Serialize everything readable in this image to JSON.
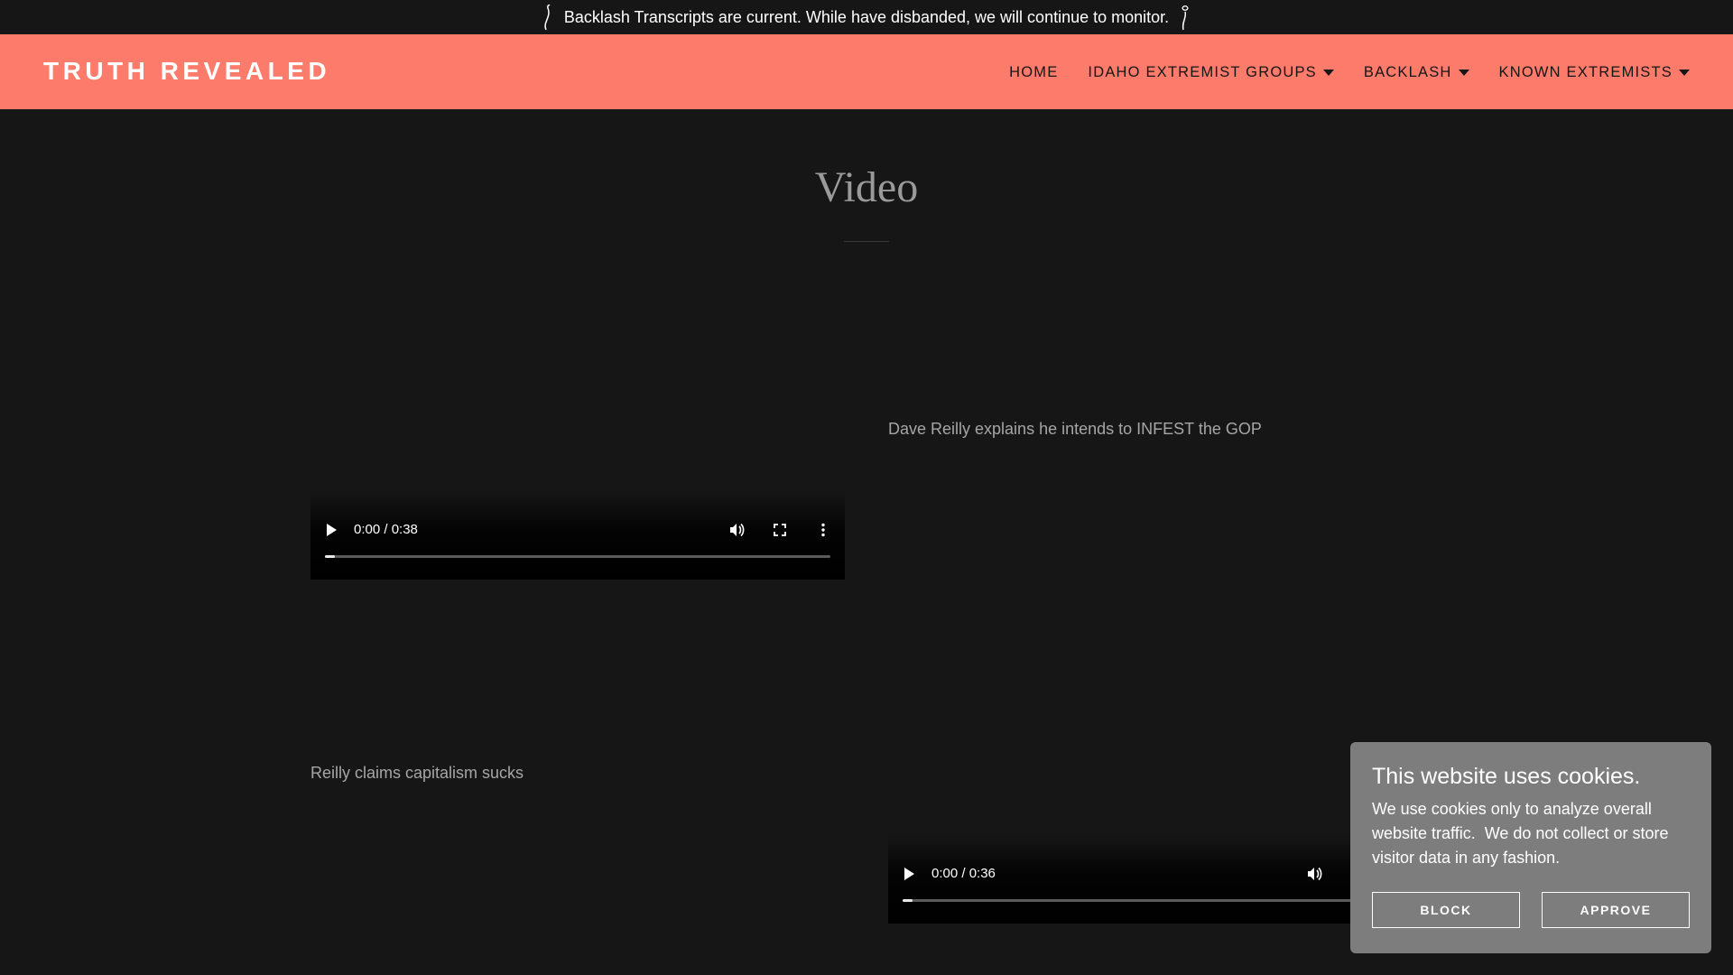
{
  "announcement": {
    "text": "Backlash Transcripts are current. While have disbanded, we will continue to monitor.",
    "icon_left": "flower-stem-icon",
    "icon_right": "rose-icon"
  },
  "header": {
    "brand": "TRUTH REVEALED",
    "background": "#fd7b6a",
    "nav": [
      {
        "label": "HOME",
        "dropdown": false
      },
      {
        "label": "IDAHO EXTREMIST GROUPS",
        "dropdown": true
      },
      {
        "label": "BACKLASH",
        "dropdown": true
      },
      {
        "label": "KNOWN EXTREMISTS",
        "dropdown": true
      }
    ]
  },
  "main": {
    "title": "Video",
    "items": [
      {
        "caption": "Dave Reilly explains he intends to INFEST the GOP"
      },
      {
        "caption": "Reilly claims capitalism sucks"
      }
    ],
    "videos": [
      {
        "time": "0:00 / 0:38",
        "progress": 0.02
      },
      {
        "time": "0:00 / 0:36",
        "progress": 0.02
      }
    ]
  },
  "cookie": {
    "title": "This website uses cookies.",
    "body": "We use cookies only to analyze overall website traffic.  We do not collect or store visitor data in any fashion.",
    "block_label": "BLOCK",
    "approve_label": "APPROVE"
  },
  "colors": {
    "accent": "#fd7b6a",
    "background": "#161616",
    "cookie_bg": "#7d7d7d"
  }
}
